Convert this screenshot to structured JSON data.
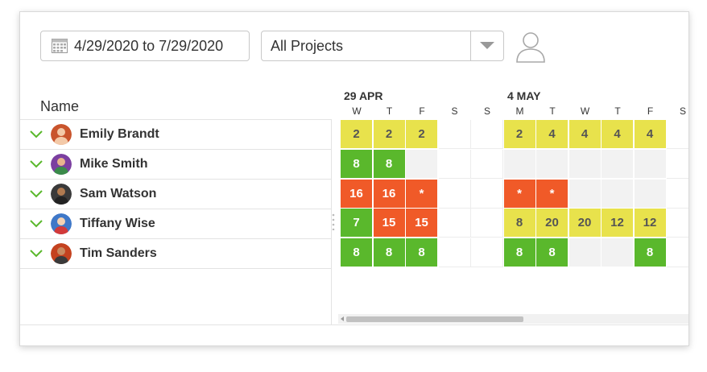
{
  "toolbar": {
    "date_range": "4/29/2020 to 7/29/2020",
    "project_filter": "All Projects"
  },
  "grid": {
    "name_header": "Name",
    "weeks": [
      {
        "label": "29 APR",
        "days": [
          "W",
          "T",
          "F",
          "S",
          "S"
        ]
      },
      {
        "label": "4 MAY",
        "days": [
          "M",
          "T",
          "W",
          "T",
          "F",
          "S"
        ]
      }
    ],
    "people": [
      {
        "name": "Emily Brandt",
        "avatar_color": "#c9542c",
        "hours": [
          "2",
          "2",
          "2",
          "",
          "",
          "2",
          "4",
          "4",
          "4",
          "4",
          ""
        ],
        "status": [
          "y",
          "y",
          "y",
          "",
          "",
          "y",
          "y",
          "y",
          "y",
          "y",
          ""
        ]
      },
      {
        "name": "Mike Smith",
        "avatar_color": "#7b3fa0",
        "hours": [
          "8",
          "8",
          "",
          "",
          "",
          "",
          "",
          "",
          "",
          "",
          ""
        ],
        "status": [
          "g",
          "g",
          "e",
          "",
          "",
          "e",
          "e",
          "e",
          "e",
          "e",
          ""
        ]
      },
      {
        "name": "Sam Watson",
        "avatar_color": "#3a3a3a",
        "hours": [
          "16",
          "16",
          "*",
          "",
          "",
          "*",
          "*",
          "",
          "",
          "",
          ""
        ],
        "status": [
          "r",
          "r",
          "r",
          "",
          "",
          "r",
          "r",
          "e",
          "e",
          "e",
          ""
        ]
      },
      {
        "name": "Tiffany Wise",
        "avatar_color": "#3f78c8",
        "hours": [
          "7",
          "15",
          "15",
          "",
          "",
          "8",
          "20",
          "20",
          "12",
          "12",
          ""
        ],
        "status": [
          "g",
          "r",
          "r",
          "",
          "",
          "y",
          "y",
          "y",
          "y",
          "y",
          ""
        ]
      },
      {
        "name": "Tim Sanders",
        "avatar_color": "#c4421f",
        "hours": [
          "8",
          "8",
          "8",
          "",
          "",
          "8",
          "8",
          "",
          "",
          "8",
          ""
        ],
        "status": [
          "g",
          "g",
          "g",
          "",
          "",
          "g",
          "g",
          "e",
          "e",
          "g",
          ""
        ]
      }
    ]
  },
  "colors": {
    "green": "#5ab82c",
    "yellow": "#e8e24c",
    "red": "#f05a28",
    "empty": "#f2f2f2",
    "check": "#5ab82c"
  }
}
